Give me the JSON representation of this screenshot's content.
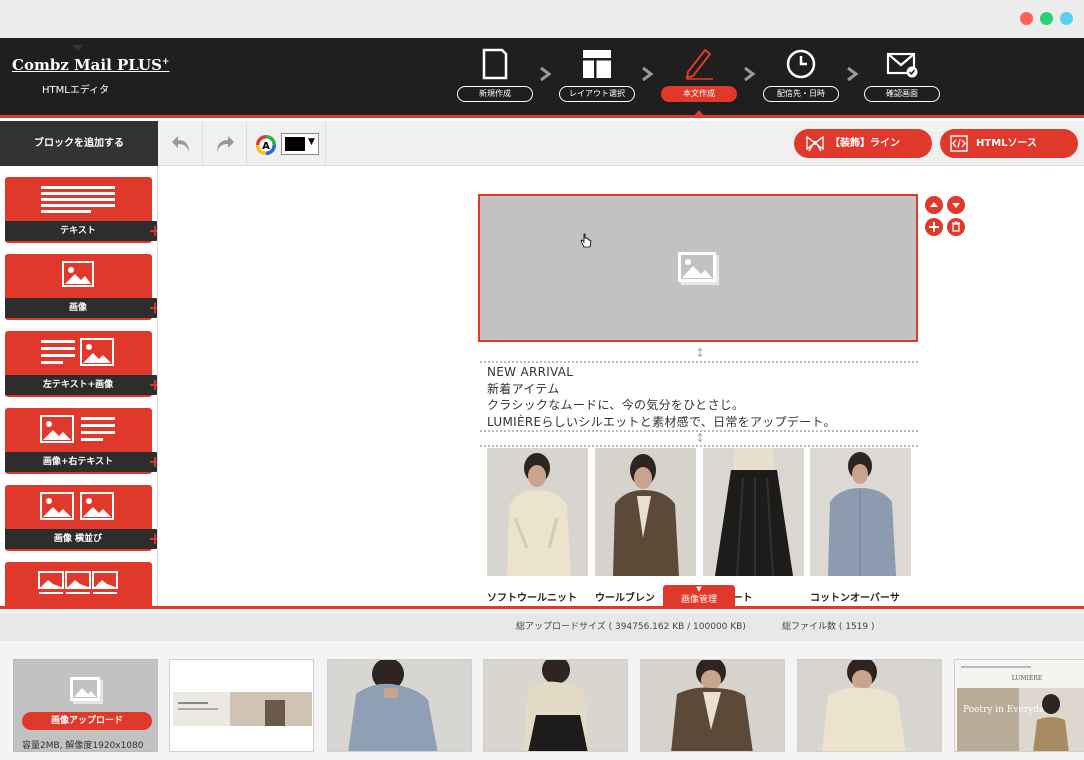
{
  "window": {
    "colors": {
      "close": "#ff5f57",
      "min": "#2bd173",
      "max": "#5ad0ef"
    }
  },
  "header": {
    "logo": "Combz Mail PLUS",
    "logo_sup": "+",
    "subtitle": "HTMLエディタ",
    "steps": [
      {
        "label": "新規作成",
        "icon": "new-document-icon"
      },
      {
        "label": "レイアウト選択",
        "icon": "layout-icon"
      },
      {
        "label": "本文作成",
        "icon": "pen-icon",
        "active": true
      },
      {
        "label": "配信先・日時",
        "icon": "clock-icon"
      },
      {
        "label": "確認画面",
        "icon": "mail-check-icon"
      }
    ]
  },
  "toolbar": {
    "add_block": "ブロックを追加する",
    "undo_icon": "undo-icon",
    "redo_icon": "redo-icon",
    "text_color_icon": "text-color-icon",
    "selected_color": "#000000",
    "decoration_line": "【装飾】ライン",
    "html_source": "HTMLソース"
  },
  "sidebar": {
    "blocks": [
      {
        "label": "テキスト",
        "icon": "text-lines-icon"
      },
      {
        "label": "画像",
        "icon": "image-icon"
      },
      {
        "label": "左テキスト+画像",
        "icon": "text-image-icon"
      },
      {
        "label": "画像+右テキスト",
        "icon": "image-text-icon"
      },
      {
        "label": "画像 横並び",
        "icon": "two-images-icon"
      },
      {
        "label": "",
        "icon": "three-images-icon"
      }
    ]
  },
  "canvas": {
    "image_placeholder_icon": "image-placeholder-icon",
    "text_lines": [
      "NEW ARRIVAL",
      "新着アイテム",
      "クラシックなムードに、今の気分をひとさじ。",
      "LUMIÈREらしいシルエットと素材感で、日常をアップデート。"
    ],
    "products": [
      {
        "name": "ソフトウールニット"
      },
      {
        "name": "ウールブレン"
      },
      {
        "name": "ースカート"
      },
      {
        "name": "コットンオーバーサ"
      }
    ]
  },
  "image_manager": {
    "tab_label": "画像管理",
    "total_size": "総アップロードサイズ ( 394756.162 KB / 100000 KB)",
    "file_count": "総ファイル数 ( 1519 )",
    "upload_button": "画像アップロード",
    "upload_note": "容量2MB, 解像度1920x1080",
    "thumb_poster_brand": "LUMIÈRE",
    "thumb_poster_text": "Poetry in Everyday."
  }
}
